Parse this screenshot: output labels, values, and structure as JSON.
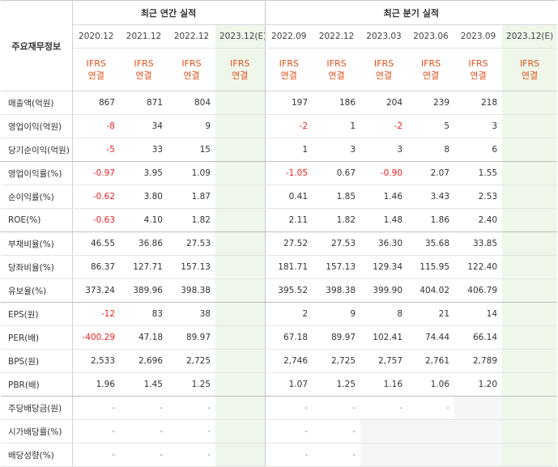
{
  "corner_label": "주요재무정보",
  "annual_header": "최근 연간 실적",
  "quarter_header": "최근 분기 실적",
  "columns": [
    "2020.12",
    "2021.12",
    "2022.12",
    "2023.12(E)",
    "2022.09",
    "2022.12",
    "2023.03",
    "2023.06",
    "2023.09",
    "2023.12(E)"
  ],
  "ifrs_line1": "IFRS",
  "ifrs_line2": "연결",
  "rows": [
    {
      "label": "매출액(억원)",
      "values": [
        "867",
        "871",
        "804",
        "",
        "197",
        "186",
        "204",
        "239",
        "218",
        ""
      ]
    },
    {
      "label": "영업이익(억원)",
      "values": [
        "-8",
        "34",
        "9",
        "",
        "-2",
        "1",
        "-2",
        "5",
        "3",
        ""
      ]
    },
    {
      "label": "당기순이익(억원)",
      "values": [
        "-5",
        "33",
        "15",
        "",
        "1",
        "3",
        "3",
        "8",
        "6",
        ""
      ]
    },
    {
      "label": "영업이익률(%)",
      "values": [
        "-0.97",
        "3.95",
        "1.09",
        "",
        "-1.05",
        "0.67",
        "-0.90",
        "2.07",
        "1.55",
        ""
      ]
    },
    {
      "label": "순이익률(%)",
      "values": [
        "-0.62",
        "3.80",
        "1.87",
        "",
        "0.41",
        "1.85",
        "1.46",
        "3.43",
        "2.53",
        ""
      ]
    },
    {
      "label": "ROE(%)",
      "values": [
        "-0.63",
        "4.10",
        "1.82",
        "",
        "2.11",
        "1.82",
        "1.48",
        "1.86",
        "2.40",
        ""
      ]
    },
    {
      "label": "부채비율(%)",
      "values": [
        "46.55",
        "36.86",
        "27.53",
        "",
        "27.52",
        "27.53",
        "36.30",
        "35.68",
        "33.85",
        ""
      ]
    },
    {
      "label": "당좌비율(%)",
      "values": [
        "86.37",
        "127.71",
        "157.13",
        "",
        "181.71",
        "157.13",
        "129.34",
        "115.95",
        "122.40",
        ""
      ]
    },
    {
      "label": "유보율(%)",
      "values": [
        "373.24",
        "389.96",
        "398.38",
        "",
        "395.52",
        "398.38",
        "399.90",
        "404.02",
        "406.79",
        ""
      ]
    },
    {
      "label": "EPS(원)",
      "values": [
        "-12",
        "83",
        "38",
        "",
        "2",
        "9",
        "8",
        "21",
        "14",
        ""
      ]
    },
    {
      "label": "PER(배)",
      "values": [
        "-400.29",
        "47.18",
        "89.97",
        "",
        "67.18",
        "89.97",
        "102.41",
        "74.44",
        "66.14",
        ""
      ]
    },
    {
      "label": "BPS(원)",
      "values": [
        "2,533",
        "2,696",
        "2,725",
        "",
        "2,746",
        "2,725",
        "2,757",
        "2,761",
        "2,789",
        ""
      ]
    },
    {
      "label": "PBR(배)",
      "values": [
        "1.96",
        "1.45",
        "1.25",
        "",
        "1.07",
        "1.25",
        "1.16",
        "1.06",
        "1.20",
        ""
      ]
    },
    {
      "label": "주당배당금(원)",
      "values": [
        "-",
        "-",
        "-",
        "",
        "-",
        "-",
        "-",
        "-",
        "",
        ""
      ]
    },
    {
      "label": "시가배당률(%)",
      "values": [
        "-",
        "-",
        "-",
        "",
        "-",
        "-",
        "",
        "",
        "",
        ""
      ]
    },
    {
      "label": "배당성향(%)",
      "values": [
        "-",
        "-",
        "-",
        "",
        "-",
        "-",
        "",
        "",
        "",
        ""
      ]
    }
  ]
}
